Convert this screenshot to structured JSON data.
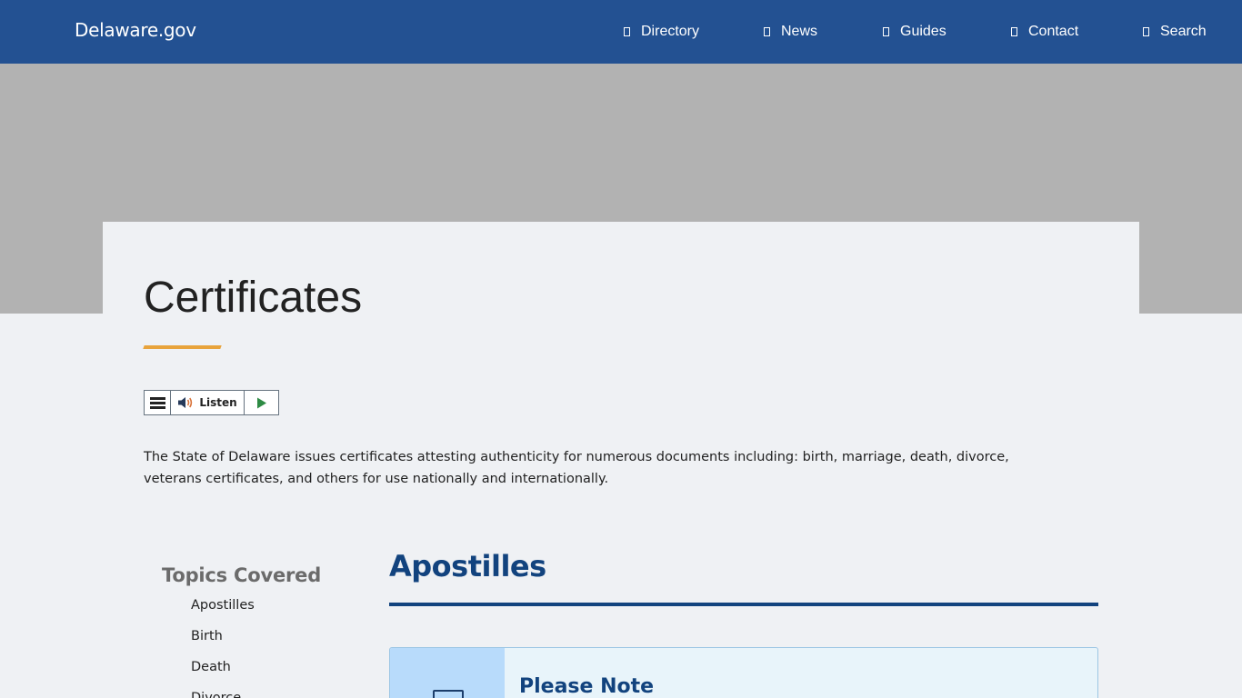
{
  "header": {
    "logo": "Delaware.gov",
    "nav": [
      {
        "label": "Directory",
        "icon": "directory-icon"
      },
      {
        "label": "News",
        "icon": "news-icon"
      },
      {
        "label": "Guides",
        "icon": "guides-icon"
      },
      {
        "label": "Contact",
        "icon": "contact-icon"
      },
      {
        "label": "Search",
        "icon": "search-icon"
      }
    ]
  },
  "page": {
    "title": "Certificates",
    "accent_color": "#e8a33b",
    "intro": "The State of Delaware issues certificates attesting authenticity for numerous documents including: birth, marriage, death, divorce, veterans certificates, and others for use nationally and internationally."
  },
  "listen_widget": {
    "menu_icon": "menu-icon",
    "speaker_icon": "speaker-icon",
    "label": "Listen",
    "play_icon": "play-icon"
  },
  "sidebar": {
    "title": "Topics Covered",
    "items": [
      "Apostilles",
      "Birth",
      "Death",
      "Divorce"
    ]
  },
  "main": {
    "section_heading": "Apostilles",
    "heading_color": "#12437e",
    "note": {
      "title": "Please Note",
      "icon": "note-icon"
    }
  },
  "colors": {
    "header_bg": "#235192",
    "hero_bg": "#b2b2b2",
    "page_bg": "#eff1f4"
  }
}
